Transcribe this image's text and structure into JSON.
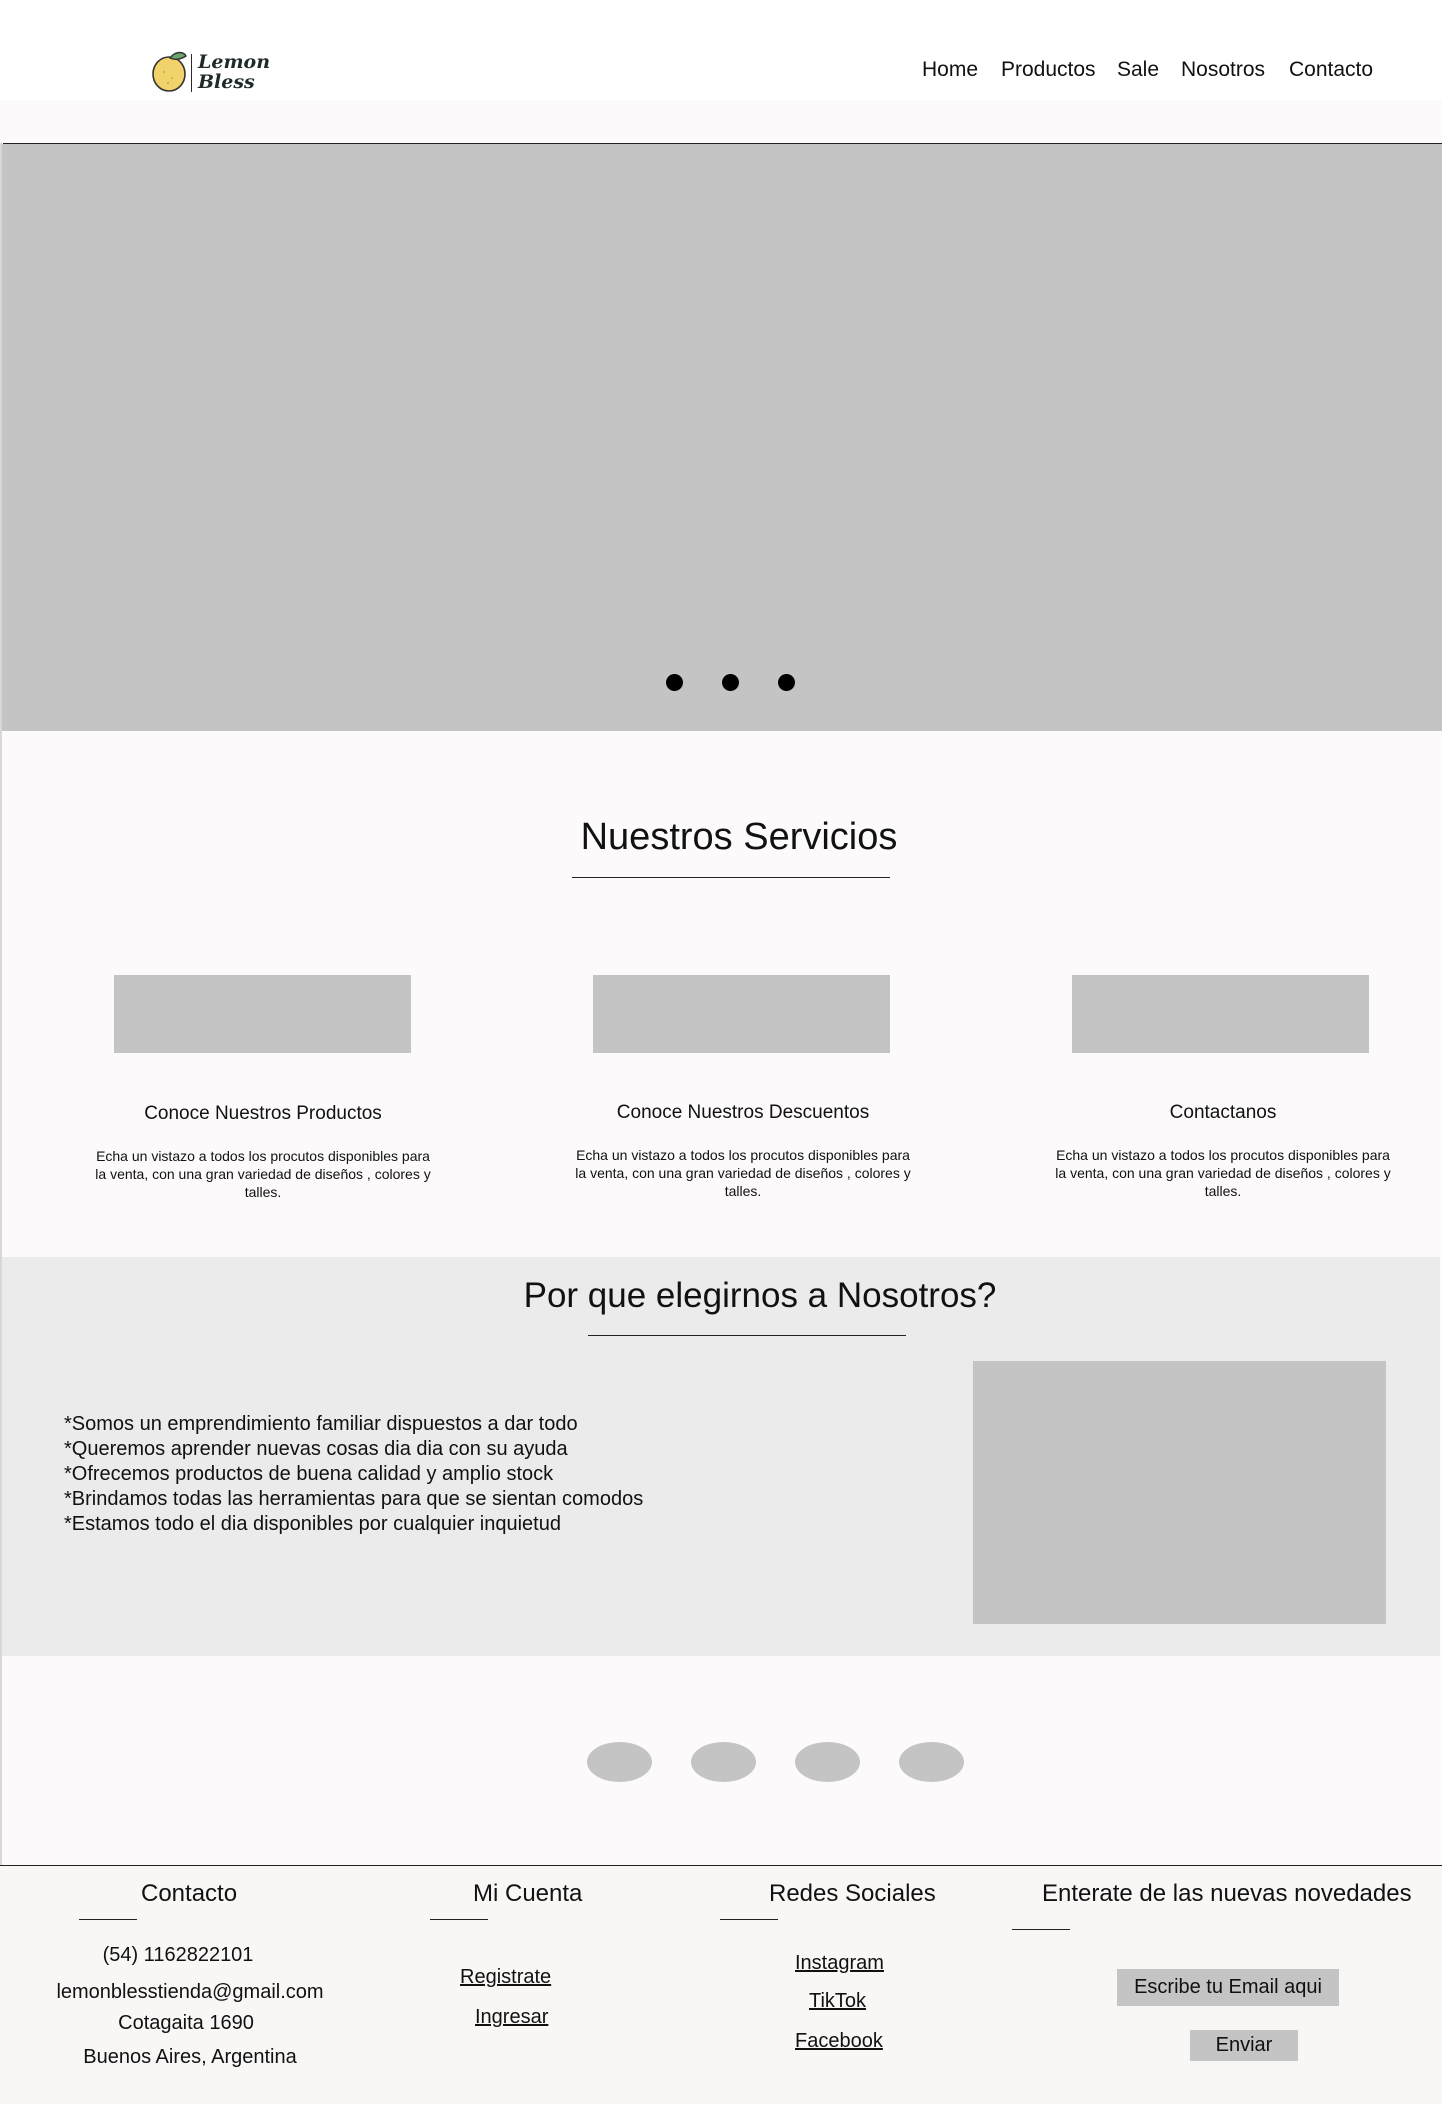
{
  "brand": {
    "logo_text_line1": "Lemon",
    "logo_text_line2": "Bless"
  },
  "nav": {
    "items": [
      "Home",
      "Productos",
      "Sale",
      "Nosotros",
      "Contacto"
    ]
  },
  "hero": {
    "slides_count": 3
  },
  "services": {
    "title": "Nuestros Servicios",
    "cards": [
      {
        "title": "Conoce Nuestros Productos",
        "text": "Echa un vistazo a todos los procutos disponibles para la venta, con una gran variedad de diseños , colores y talles."
      },
      {
        "title": "Conoce Nuestros Descuentos",
        "text": "Echa un vistazo a todos los procutos disponibles para la venta, con una gran variedad de diseños , colores y talles."
      },
      {
        "title": "Contactanos",
        "text": "Echa un vistazo a todos los procutos disponibles para la venta, con una gran variedad de diseños , colores y talles."
      }
    ]
  },
  "why": {
    "title": "Por que elegirnos a Nosotros?",
    "points": [
      "*Somos un emprendimiento familiar dispuestos a dar todo",
      "*Queremos aprender nuevas cosas dia dia con su ayuda",
      "*Ofrecemos productos de buena calidad y amplio stock",
      "*Brindamos todas las herramientas para que se sientan comodos",
      "*Estamos todo el dia disponibles por cualquier inquietud"
    ]
  },
  "footer": {
    "contact": {
      "heading": "Contacto",
      "phone": "(54) 1162822101",
      "email": "lemonblesstienda@gmail.com",
      "address": "Cotagaita 1690",
      "city": "Buenos Aires, Argentina"
    },
    "account": {
      "heading": "Mi Cuenta",
      "register": "Registrate",
      "login": "Ingresar"
    },
    "social": {
      "heading": "Redes Sociales",
      "instagram": "Instagram",
      "tiktok": "TikTok",
      "facebook": "Facebook"
    },
    "newsletter": {
      "heading": "Enterate de las nuevas novedades",
      "placeholder": "Escribe tu Email aqui",
      "button": "Enviar"
    }
  },
  "colors": {
    "placeholder_gray": "#c4c4c4",
    "section_gray": "#ebebeb",
    "page_bg": "#fcfafa",
    "lemon": "#f2d36b",
    "leaf": "#6aa46a"
  }
}
